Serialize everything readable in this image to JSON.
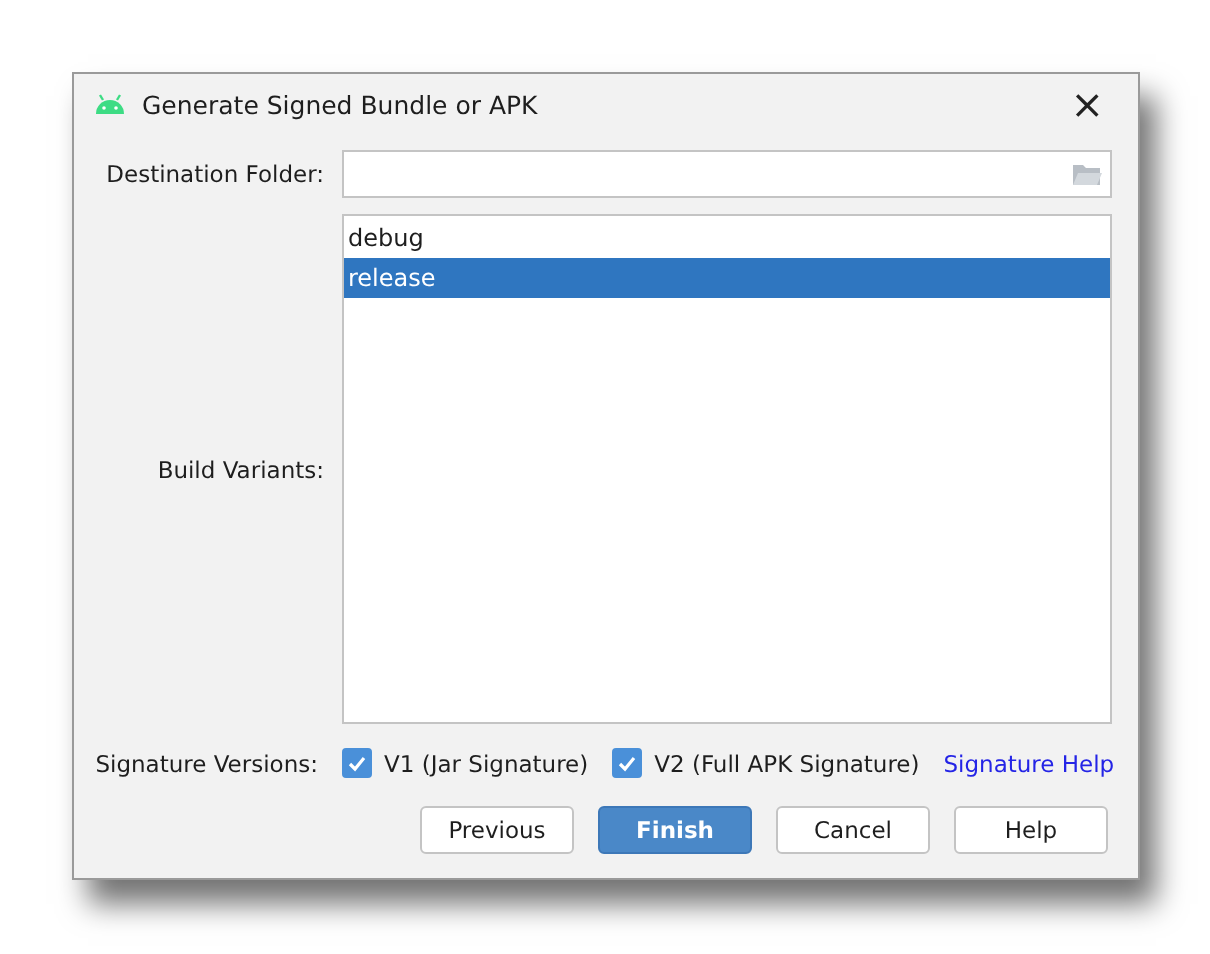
{
  "window": {
    "title": "Generate Signed Bundle or APK",
    "close": "×"
  },
  "destination_folder": {
    "label": "Destination Folder:"
  },
  "build_variants": {
    "label": "Build Variants:",
    "items": [
      {
        "label": "debug",
        "selected": false
      },
      {
        "label": "release",
        "selected": true
      }
    ]
  },
  "signature_versions": {
    "label": "Signature Versions:",
    "options": [
      {
        "label": "V1 (Jar Signature)",
        "checked": true
      },
      {
        "label": "V2 (Full APK Signature)",
        "checked": true
      }
    ],
    "help_link": "Signature Help"
  },
  "buttons": [
    {
      "label": "Previous",
      "primary": false
    },
    {
      "label": "Finish",
      "primary": true
    },
    {
      "label": "Cancel",
      "primary": false
    },
    {
      "label": "Help",
      "primary": false
    }
  ]
}
